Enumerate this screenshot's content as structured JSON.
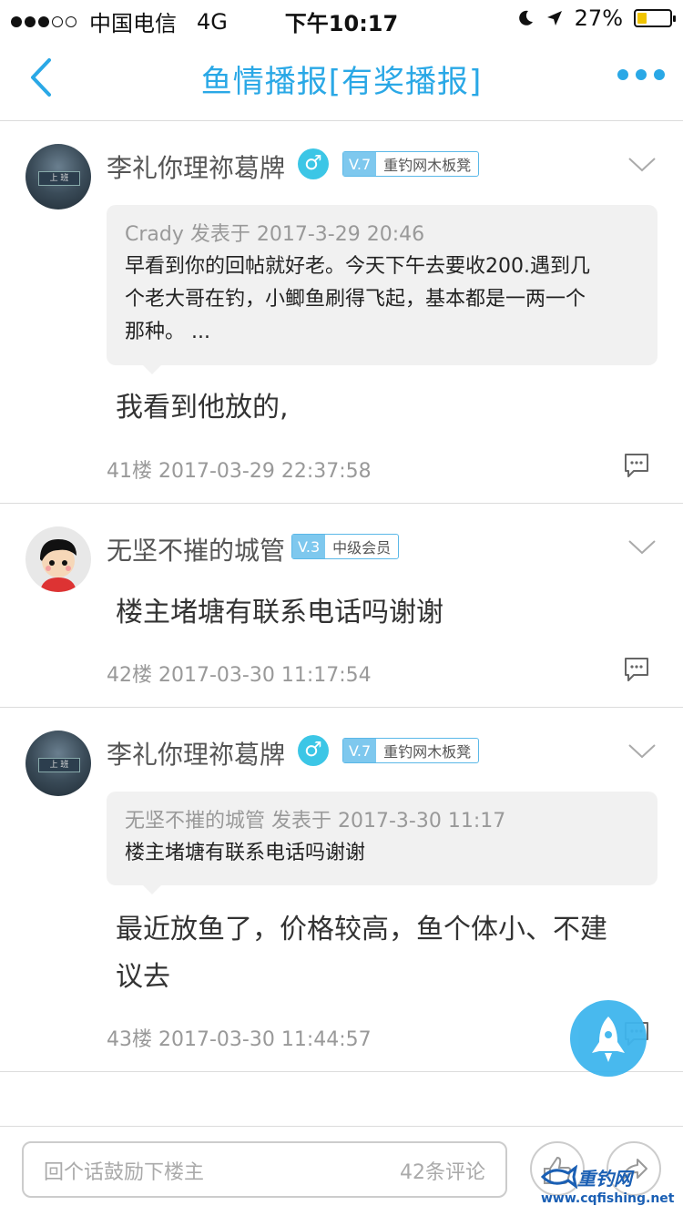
{
  "status_bar": {
    "carrier": "中国电信",
    "network": "4G",
    "time": "下午10:17",
    "battery": "27%",
    "battery_level": 0.27
  },
  "nav": {
    "title": "鱼情播报[有奖播报]"
  },
  "posts": [
    {
      "username": "李礼你理祢葛牌",
      "gender": "♂",
      "level": "V.7",
      "rank": "重钓网木板凳",
      "quote": {
        "meta": "Crady 发表于 2017-3-29 20:46",
        "lines": [
          "早看到你的回帖就好老。今天下午去要收200.遇到几",
          "个老大哥在钓，小鲫鱼刷得飞起，基本都是一两一个",
          "那种。 ..."
        ]
      },
      "content": [
        "我看到他放的,"
      ],
      "floor": "41楼 2017-03-29 22:37:58"
    },
    {
      "username": "无坚不摧的城管",
      "level": "V.3",
      "rank": "中级会员",
      "content": [
        "楼主堵塘有联系电话吗谢谢"
      ],
      "floor": "42楼 2017-03-30 11:17:54"
    },
    {
      "username": "李礼你理祢葛牌",
      "gender": "♂",
      "level": "V.7",
      "rank": "重钓网木板凳",
      "quote": {
        "meta": "无坚不摧的城管 发表于 2017-3-30 11:17",
        "lines": [
          "楼主堵塘有联系电话吗谢谢"
        ]
      },
      "content": [
        "最近放鱼了，价格较高，鱼个体小、不建",
        "议去"
      ],
      "floor": "43楼 2017-03-30 11:44:57"
    }
  ],
  "bottom_bar": {
    "placeholder": "回个话鼓励下楼主",
    "comment_count": "42条评论"
  },
  "watermark": {
    "name": "重钓网",
    "url": "www.cqfishing.net"
  },
  "colors": {
    "accent": "#2aa8e6",
    "badge": "#5bb8e8",
    "gender": "#3cc6e6",
    "battery": "#f0c400"
  }
}
